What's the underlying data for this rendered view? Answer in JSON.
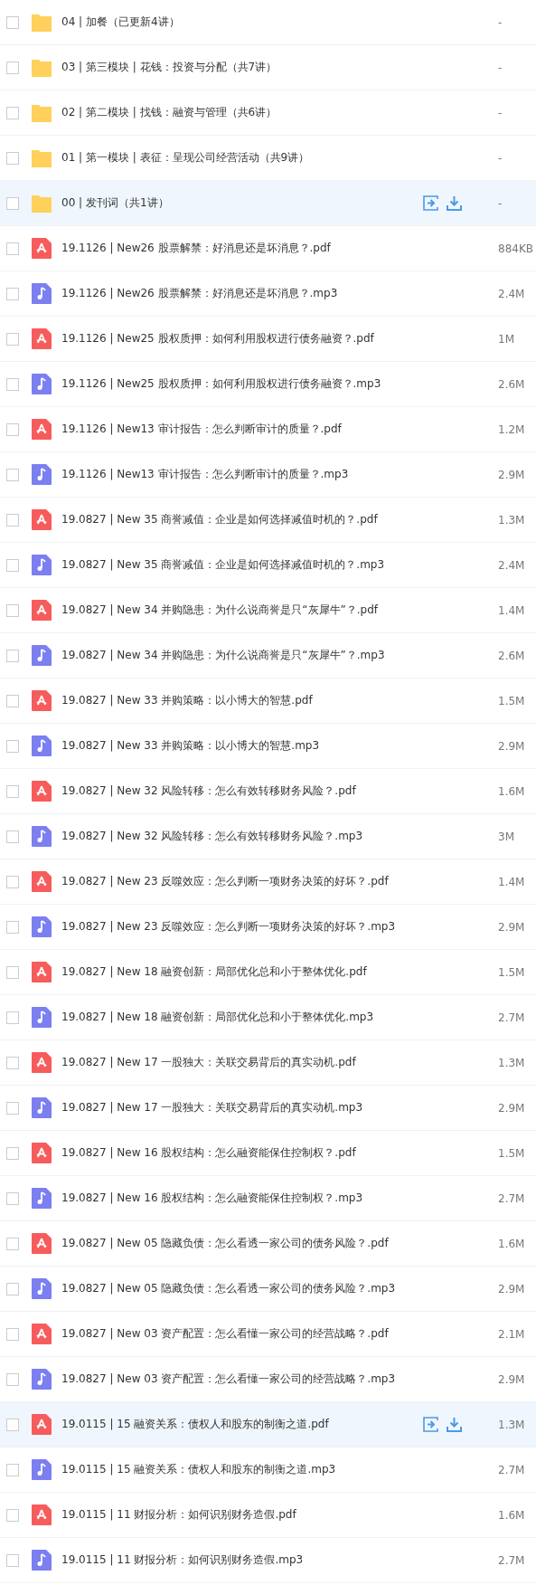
{
  "files": [
    {
      "kind": "folder",
      "name": "04 | 加餐（已更新4讲）",
      "size": "-",
      "checked": false,
      "hovered": false
    },
    {
      "kind": "folder",
      "name": "03 | 第三模块 | 花钱：投资与分配（共7讲）",
      "size": "-",
      "checked": false,
      "hovered": false
    },
    {
      "kind": "folder",
      "name": "02 | 第二模块 | 找钱：融资与管理（共6讲）",
      "size": "-",
      "checked": false,
      "hovered": false
    },
    {
      "kind": "folder",
      "name": "01 | 第一模块 | 表征：呈现公司经营活动（共9讲）",
      "size": "-",
      "checked": false,
      "hovered": false
    },
    {
      "kind": "folder",
      "name": "00 | 发刊词（共1讲）",
      "size": "-",
      "checked": false,
      "hovered": true
    },
    {
      "kind": "pdf",
      "name": "19.1126 | New26 股票解禁：好消息还是坏消息？.pdf",
      "size": "884KB",
      "checked": false,
      "hovered": false
    },
    {
      "kind": "mp3",
      "name": "19.1126 | New26 股票解禁：好消息还是坏消息？.mp3",
      "size": "2.4M",
      "checked": false,
      "hovered": false
    },
    {
      "kind": "pdf",
      "name": "19.1126 | New25 股权质押：如何利用股权进行债务融资？.pdf",
      "size": "1M",
      "checked": false,
      "hovered": false
    },
    {
      "kind": "mp3",
      "name": "19.1126 | New25 股权质押：如何利用股权进行债务融资？.mp3",
      "size": "2.6M",
      "checked": false,
      "hovered": false
    },
    {
      "kind": "pdf",
      "name": "19.1126 | New13 审计报告：怎么判断审计的质量？.pdf",
      "size": "1.2M",
      "checked": false,
      "hovered": false
    },
    {
      "kind": "mp3",
      "name": "19.1126 | New13 审计报告：怎么判断审计的质量？.mp3",
      "size": "2.9M",
      "checked": false,
      "hovered": false
    },
    {
      "kind": "pdf",
      "name": "19.0827 | New 35 商誉减值：企业是如何选择减值时机的？.pdf",
      "size": "1.3M",
      "checked": false,
      "hovered": false
    },
    {
      "kind": "mp3",
      "name": "19.0827 | New 35 商誉减值：企业是如何选择减值时机的？.mp3",
      "size": "2.4M",
      "checked": false,
      "hovered": false
    },
    {
      "kind": "pdf",
      "name": "19.0827 | New 34 并购隐患：为什么说商誉是只“灰犀牛”？.pdf",
      "size": "1.4M",
      "checked": false,
      "hovered": false
    },
    {
      "kind": "mp3",
      "name": "19.0827 | New 34 并购隐患：为什么说商誉是只“灰犀牛”？.mp3",
      "size": "2.6M",
      "checked": false,
      "hovered": false
    },
    {
      "kind": "pdf",
      "name": "19.0827 | New 33 并购策略：以小博大的智慧.pdf",
      "size": "1.5M",
      "checked": false,
      "hovered": false
    },
    {
      "kind": "mp3",
      "name": "19.0827 | New 33 并购策略：以小博大的智慧.mp3",
      "size": "2.9M",
      "checked": false,
      "hovered": false
    },
    {
      "kind": "pdf",
      "name": "19.0827 | New 32 风险转移：怎么有效转移财务风险？.pdf",
      "size": "1.6M",
      "checked": false,
      "hovered": false
    },
    {
      "kind": "mp3",
      "name": "19.0827 | New 32 风险转移：怎么有效转移财务风险？.mp3",
      "size": "3M",
      "checked": false,
      "hovered": false
    },
    {
      "kind": "pdf",
      "name": "19.0827 | New 23 反噬效应：怎么判断一项财务决策的好坏？.pdf",
      "size": "1.4M",
      "checked": false,
      "hovered": false
    },
    {
      "kind": "mp3",
      "name": "19.0827 | New 23 反噬效应：怎么判断一项财务决策的好坏？.mp3",
      "size": "2.9M",
      "checked": false,
      "hovered": false
    },
    {
      "kind": "pdf",
      "name": "19.0827 | New 18 融资创新：局部优化总和小于整体优化.pdf",
      "size": "1.5M",
      "checked": false,
      "hovered": false
    },
    {
      "kind": "mp3",
      "name": "19.0827 | New 18 融资创新：局部优化总和小于整体优化.mp3",
      "size": "2.7M",
      "checked": false,
      "hovered": false
    },
    {
      "kind": "pdf",
      "name": "19.0827 | New 17 一股独大：关联交易背后的真实动机.pdf",
      "size": "1.3M",
      "checked": false,
      "hovered": false
    },
    {
      "kind": "mp3",
      "name": "19.0827 | New 17 一股独大：关联交易背后的真实动机.mp3",
      "size": "2.9M",
      "checked": false,
      "hovered": false
    },
    {
      "kind": "pdf",
      "name": "19.0827 | New 16 股权结构：怎么融资能保住控制权？.pdf",
      "size": "1.5M",
      "checked": false,
      "hovered": false
    },
    {
      "kind": "mp3",
      "name": "19.0827 | New 16 股权结构：怎么融资能保住控制权？.mp3",
      "size": "2.7M",
      "checked": false,
      "hovered": false
    },
    {
      "kind": "pdf",
      "name": "19.0827 | New 05 隐藏负债：怎么看透一家公司的债务风险？.pdf",
      "size": "1.6M",
      "checked": false,
      "hovered": false
    },
    {
      "kind": "mp3",
      "name": "19.0827 | New 05 隐藏负债：怎么看透一家公司的债务风险？.mp3",
      "size": "2.9M",
      "checked": false,
      "hovered": false
    },
    {
      "kind": "pdf",
      "name": "19.0827 | New 03 资产配置：怎么看懂一家公司的经营战略？.pdf",
      "size": "2.1M",
      "checked": false,
      "hovered": false
    },
    {
      "kind": "mp3",
      "name": "19.0827 | New 03 资产配置：怎么看懂一家公司的经营战略？.mp3",
      "size": "2.9M",
      "checked": false,
      "hovered": false
    },
    {
      "kind": "pdf",
      "name": "19.0115 | 15 融资关系：债权人和股东的制衡之道.pdf",
      "size": "1.3M",
      "checked": false,
      "hovered": true
    },
    {
      "kind": "mp3",
      "name": "19.0115 | 15 融资关系：债权人和股东的制衡之道.mp3",
      "size": "2.7M",
      "checked": false,
      "hovered": false
    },
    {
      "kind": "pdf",
      "name": "19.0115 | 11 财报分析：如何识别财务造假.pdf",
      "size": "1.6M",
      "checked": false,
      "hovered": false
    },
    {
      "kind": "mp3",
      "name": "19.0115 | 11 财报分析：如何识别财务造假.mp3",
      "size": "2.7M",
      "checked": false,
      "hovered": false
    }
  ]
}
